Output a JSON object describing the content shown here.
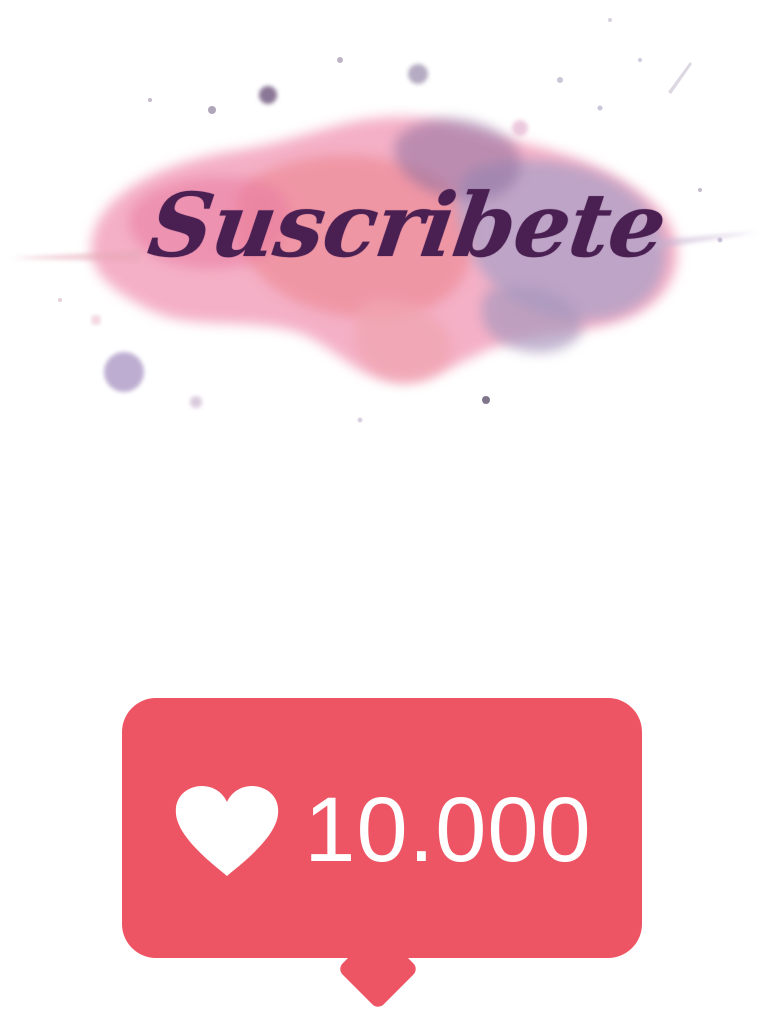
{
  "logo": {
    "text": "Suscribete",
    "colors": {
      "text": "#4a1f52",
      "splash_pink": "#f3a3bd",
      "splash_coral": "#ee8e9a",
      "splash_lilac": "#b5a2c6",
      "splash_violet": "#8f6f9f"
    }
  },
  "like_badge": {
    "icon": "heart-icon",
    "count": "10.000",
    "colors": {
      "background": "#ee5564",
      "foreground": "#ffffff"
    }
  }
}
